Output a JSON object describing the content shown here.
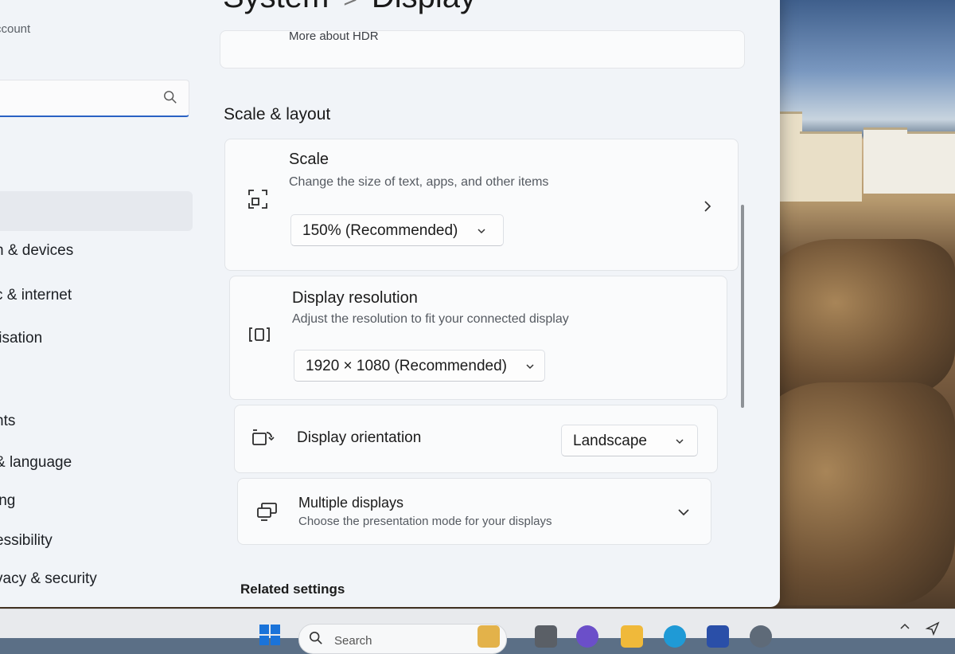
{
  "sidebar": {
    "account_text": "ccount",
    "search_placeholder": "",
    "items": [
      {
        "label": "h & devices"
      },
      {
        "label": "c & internet"
      },
      {
        "label": "lisation"
      },
      {
        "label": "nts"
      },
      {
        "label": "& language"
      },
      {
        "label": "ing"
      },
      {
        "label": "essibility"
      },
      {
        "label": "vacy & security"
      }
    ]
  },
  "header": {
    "breadcrumb_parent": "System",
    "breadcrumb_separator": ">",
    "breadcrumb_current": "Display",
    "hdr_link": "More about HDR"
  },
  "scale_layout": {
    "section_title": "Scale & layout",
    "scale": {
      "title": "Scale",
      "description": "Change the size of text, apps, and other items",
      "value": "150% (Recommended)"
    },
    "resolution": {
      "title": "Display resolution",
      "description": "Adjust the resolution to fit your connected display",
      "value": "1920 × 1080 (Recommended)"
    },
    "orientation": {
      "title": "Display orientation",
      "value": "Landscape"
    },
    "multiple": {
      "title": "Multiple displays",
      "description": "Choose the presentation mode for your displays"
    }
  },
  "related_settings": "Related settings",
  "taskbar": {
    "search_label": "Search"
  },
  "colors": {
    "accent": "#2a62c4",
    "window_bg": "#f1f4f8",
    "card_bg": "#fafbfc"
  }
}
